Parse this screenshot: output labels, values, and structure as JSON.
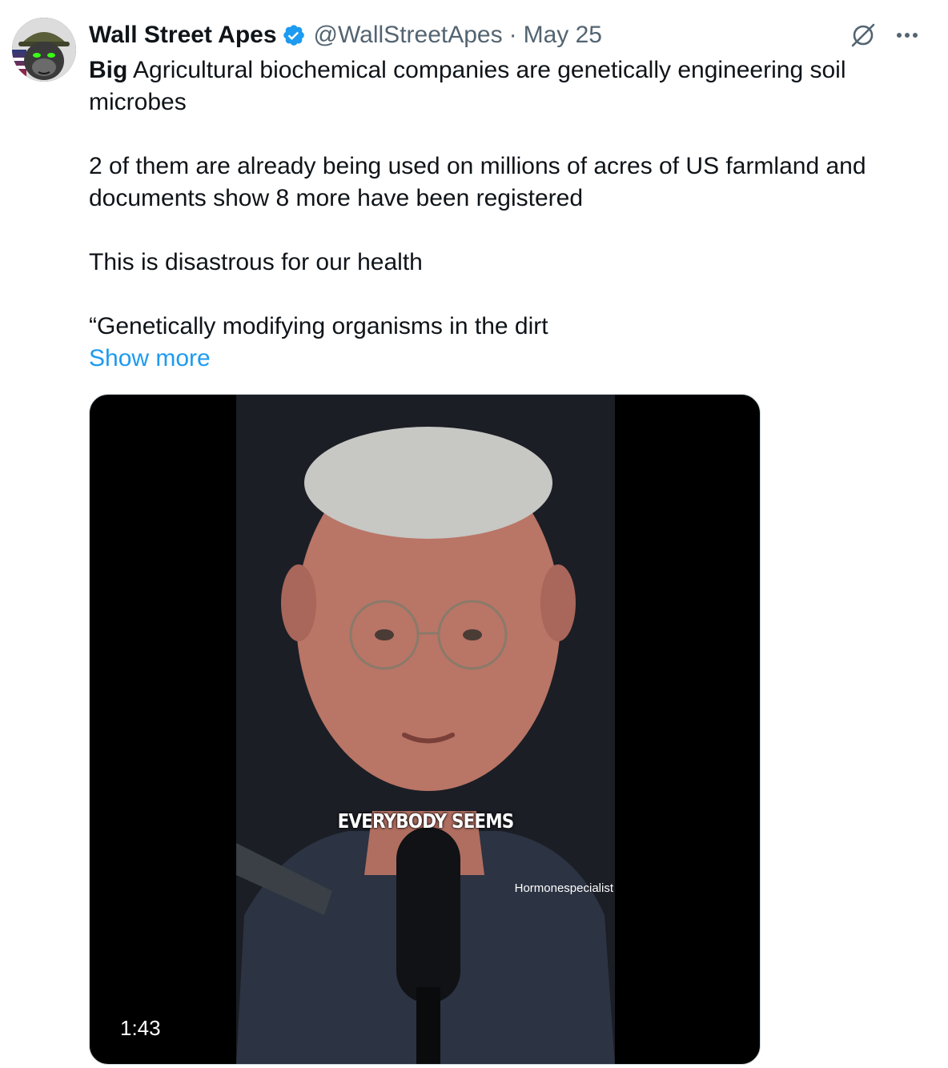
{
  "tweet": {
    "display_name": "Wall Street Apes",
    "handle": "@WallStreetApes",
    "separator": "·",
    "date": "May 25",
    "icons": {
      "avatar": "gorilla-avatar",
      "verified": "verified-badge-icon",
      "grok": "grok-icon",
      "more": "more-icon"
    },
    "text": {
      "lead_bold": "Big",
      "lead_rest": " Agricultural biochemical companies are genetically engineering soil microbes",
      "para2": "2 of them are already being used on millions of acres of US farmland and documents show 8 more have been registered",
      "para3": "This is disastrous for our health",
      "para4": "“Genetically modifying organisms in the dirt",
      "show_more": "Show more"
    },
    "media": {
      "caption": "EVERYBODY SEEMS",
      "watermark": "Hormonespecialist",
      "duration": "1:43"
    }
  },
  "colors": {
    "text_primary": "#0f1419",
    "text_secondary": "#536471",
    "link": "#1d9bf0",
    "verified": "#1d9bf0"
  }
}
